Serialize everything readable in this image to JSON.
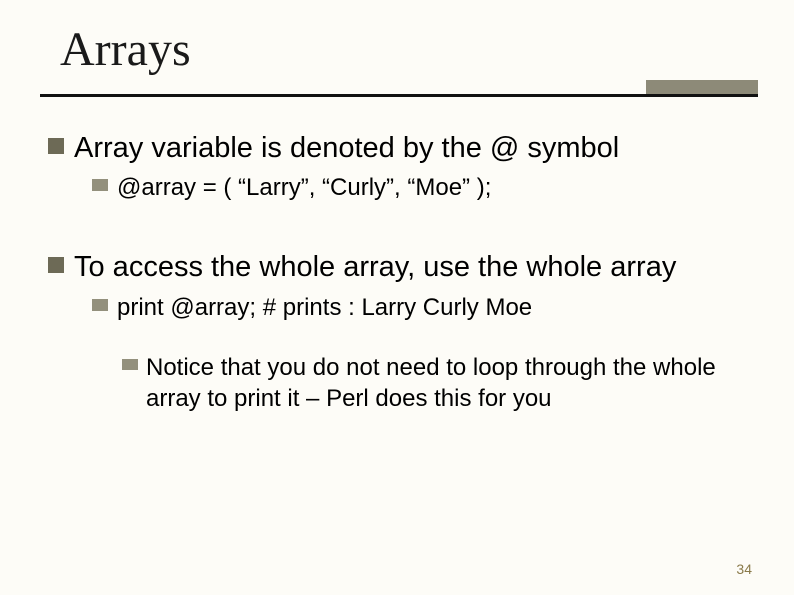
{
  "title": "Arrays",
  "bullets": {
    "b1": "Array variable is denoted by the @ symbol",
    "b1_1": "@array = ( “Larry”, “Curly”, “Moe” );",
    "b2": "To access the whole array, use the whole array",
    "b2_1": "print @array;  # prints : Larry Curly Moe",
    "b2_1_1": "Notice that you do not need to loop through the whole array to print it – Perl does this for you"
  },
  "page_number": "34"
}
